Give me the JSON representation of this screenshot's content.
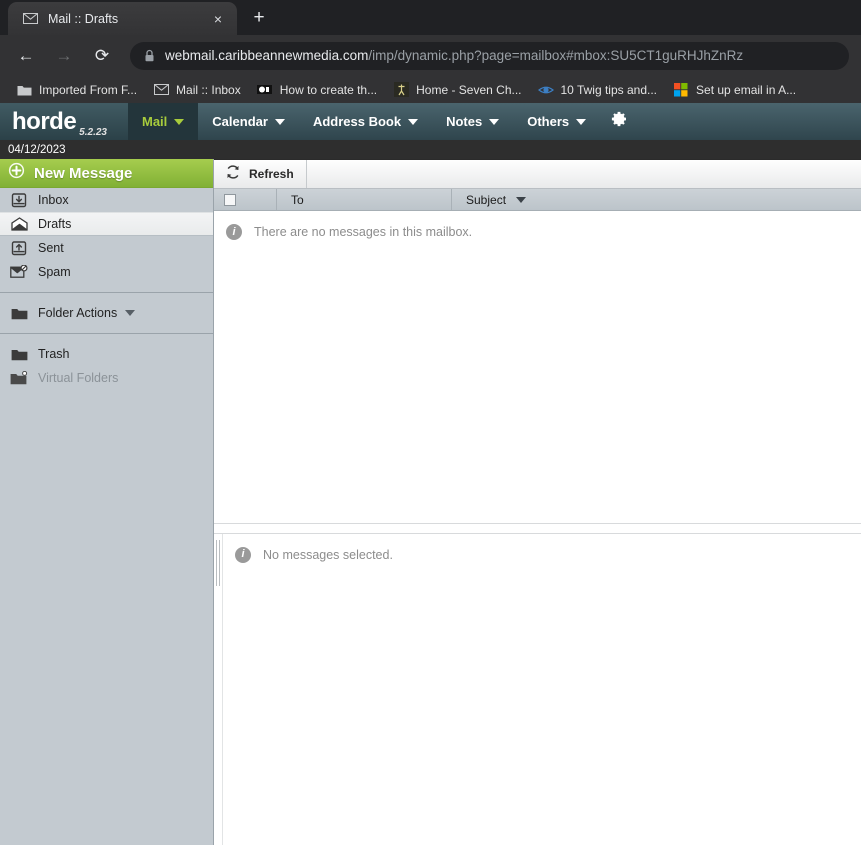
{
  "browser": {
    "tab": {
      "title": "Mail :: Drafts",
      "favicon": "envelope-icon",
      "close_label": "×"
    },
    "new_tab_label": "+",
    "nav": {
      "back_label": "←",
      "forward_label": "→",
      "reload_label": "⟳"
    },
    "omnibox": {
      "lock_icon": "padlock-icon",
      "url_host": "webmail.caribbeannewmedia.com",
      "url_path": "/imp/dynamic.php?page=mailbox#mbox:SU5CT1guRHJhZnRz"
    },
    "bookmarks": [
      {
        "label": "Imported From F...",
        "icon": "folder-icon"
      },
      {
        "label": "Mail :: Inbox",
        "icon": "envelope-icon"
      },
      {
        "label": "How to create th...",
        "icon": "film-icon"
      },
      {
        "label": "Home - Seven Ch...",
        "icon": "figure-icon"
      },
      {
        "label": "10 Twig tips and...",
        "icon": "eye-icon"
      },
      {
        "label": "Set up email in A...",
        "icon": "microsoft-icon"
      }
    ]
  },
  "horde": {
    "logo": {
      "word": "horde",
      "version": "5.2.23"
    },
    "menu": [
      {
        "label": "Mail",
        "active": true
      },
      {
        "label": "Calendar",
        "active": false
      },
      {
        "label": "Address Book",
        "active": false
      },
      {
        "label": "Notes",
        "active": false
      },
      {
        "label": "Others",
        "active": false
      }
    ],
    "settings_icon": "gear-icon",
    "date": "04/12/2023",
    "sidebar": {
      "new_message_label": "New Message",
      "new_message_icon": "plus-circle-icon",
      "folders": [
        {
          "label": "Inbox",
          "icon": "inbox-icon",
          "selected": false,
          "muted": false
        },
        {
          "label": "Drafts",
          "icon": "draft-envelope-icon",
          "selected": true,
          "muted": false
        },
        {
          "label": "Sent",
          "icon": "sent-icon",
          "selected": false,
          "muted": false
        },
        {
          "label": "Spam",
          "icon": "spam-envelope-icon",
          "selected": false,
          "muted": false
        }
      ],
      "folder_actions_label": "Folder Actions",
      "folder_actions_icon": "folder-icon",
      "bottom_folders": [
        {
          "label": "Trash",
          "icon": "folder-icon",
          "muted": false
        },
        {
          "label": "Virtual Folders",
          "icon": "virtual-folder-icon",
          "muted": true
        }
      ]
    },
    "toolbar": {
      "refresh_label": "Refresh",
      "refresh_icon": "refresh-icon"
    },
    "columns": {
      "select_all": "select-all-checkbox",
      "to": "To",
      "subject": "Subject",
      "sort_icon": "sort-desc-icon"
    },
    "messages": {
      "empty_text": "There are no messages in this mailbox.",
      "empty_icon": "info-icon"
    },
    "preview": {
      "empty_text": "No messages selected.",
      "empty_icon": "info-icon"
    }
  }
}
